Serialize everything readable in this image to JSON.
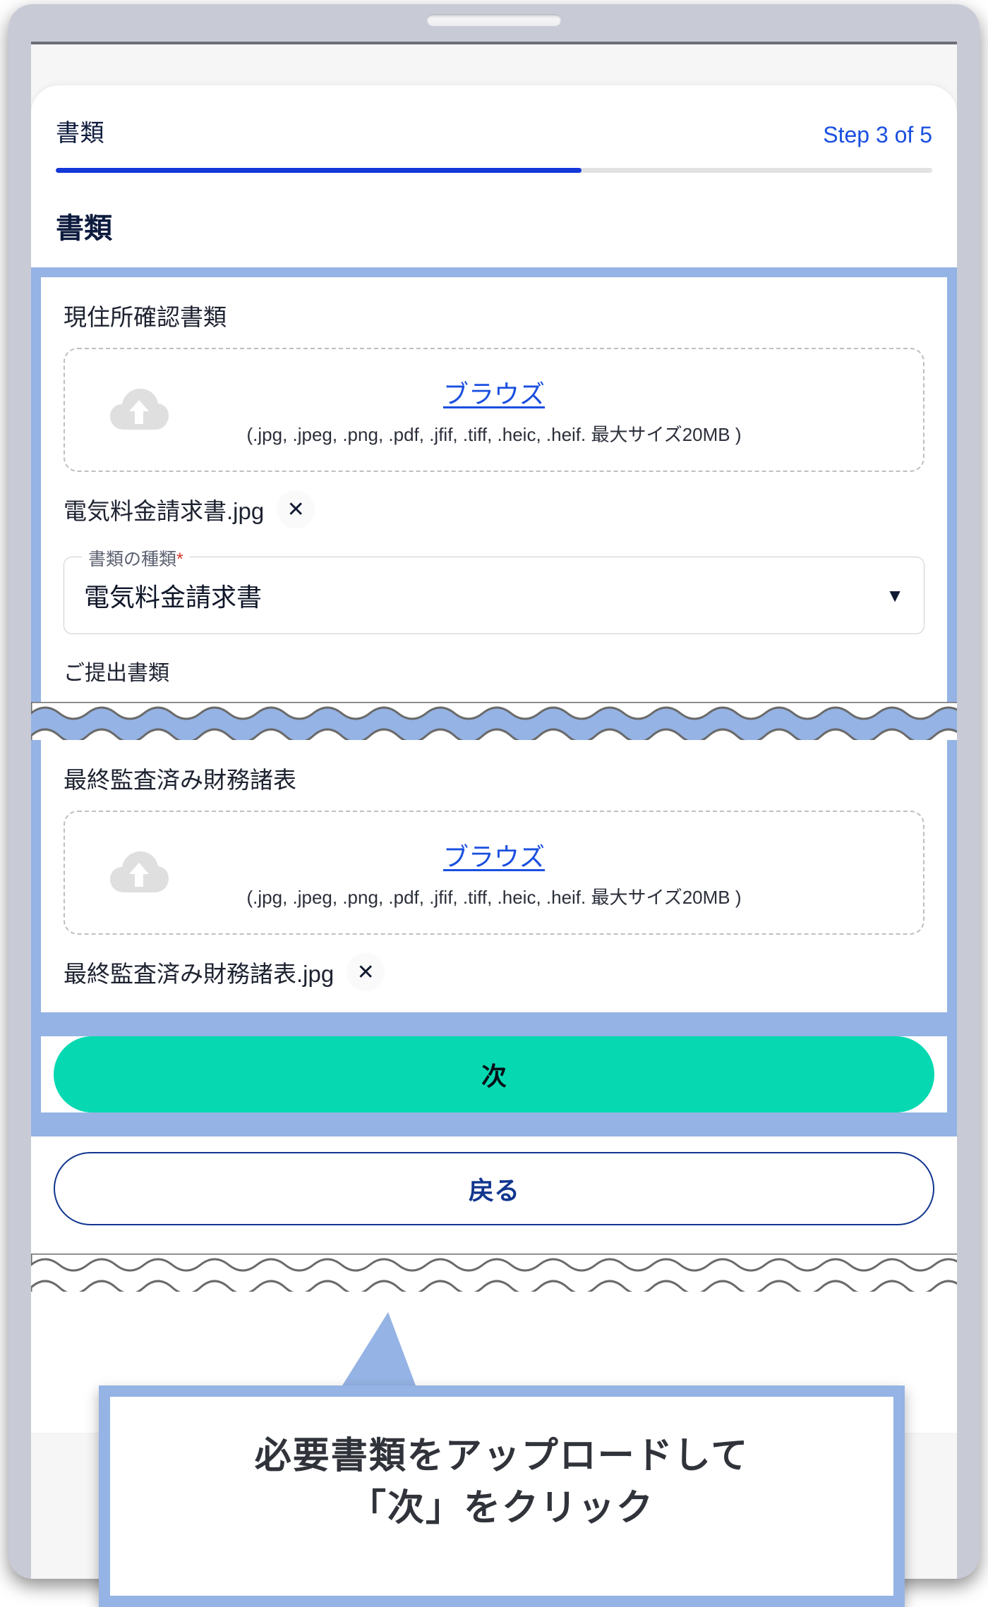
{
  "device": {
    "frame": "tablet",
    "speaker_icon": "speaker-slot"
  },
  "header": {
    "title": "書類",
    "step_label": "Step 3 of 5",
    "progress_percent": 60,
    "progress_fill_color": "#1437d8",
    "step_text_color": "#1a4fe0"
  },
  "section": {
    "title": "書類"
  },
  "blocks": [
    {
      "title": "現住所確認書類",
      "dropzone": {
        "icon": "cloud-upload-icon",
        "browse_label": "ブラウズ",
        "hint": "(.jpg, .jpeg, .png, .pdf, .jfif, .tiff, .heic, .heif. 最大サイズ20MB )"
      },
      "file": {
        "name": "電気料金請求書.jpg",
        "remove_icon": "close-icon",
        "remove_label": "✕"
      },
      "select": {
        "label": "書類の種類",
        "required_marker": "*",
        "value": "電気料金請求書",
        "caret_icon": "chevron-down-icon",
        "caret_glyph": "▼"
      },
      "sub_note": "ご提出書類"
    },
    {
      "title": "最終監査済み財務諸表",
      "dropzone": {
        "icon": "cloud-upload-icon",
        "browse_label": "ブラウズ",
        "hint": "(.jpg, .jpeg, .png, .pdf, .jfif, .tiff, .heic, .heif. 最大サイズ20MB )"
      },
      "file": {
        "name": "最終監査済み財務諸表.jpg",
        "remove_icon": "close-icon",
        "remove_label": "✕"
      }
    }
  ],
  "actions": {
    "next_label": "次",
    "back_label": "戻る",
    "next_bg_color": "#06d9b2",
    "back_border_color": "#11368f"
  },
  "callout": {
    "line1": "必要書類をアップロードして",
    "line2": "「次」をクリック",
    "frame_color": "#95b3e4"
  },
  "highlight": {
    "band_color": "#95b3e4"
  }
}
